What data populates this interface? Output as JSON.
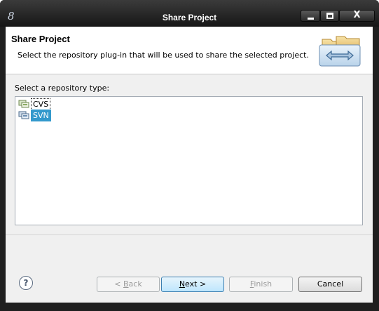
{
  "window": {
    "title": "Share Project",
    "app_icon_glyph": "8"
  },
  "caption_buttons": {
    "close_glyph": "X"
  },
  "header": {
    "title": "Share Project",
    "description": "Select the repository plug-in that will be used to share the selected project."
  },
  "repository": {
    "label": "Select a repository type:",
    "items": [
      {
        "label": "CVS",
        "icon": "cvs-repository-icon",
        "selected": false
      },
      {
        "label": "SVN",
        "icon": "svn-repository-icon",
        "selected": true
      }
    ]
  },
  "buttons": {
    "help": "?",
    "back": {
      "mnemonic": "B",
      "rest": "ack",
      "prefix": "< ",
      "enabled": false
    },
    "next": {
      "mnemonic": "N",
      "rest": "ext >",
      "enabled": true
    },
    "finish": {
      "mnemonic": "F",
      "rest": "inish",
      "enabled": false
    },
    "cancel": "Cancel"
  },
  "colors": {
    "selection": "#3399cc",
    "title_bar": "#1f1f1f"
  }
}
